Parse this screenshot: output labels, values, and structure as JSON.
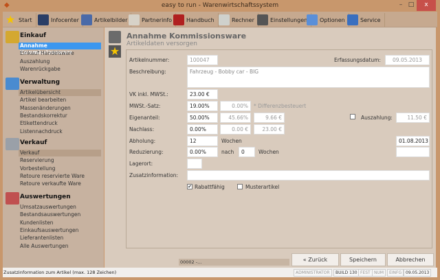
{
  "window": {
    "title": "easy to run - Warenwirtschaftssystem",
    "close": "x",
    "minimize": "–",
    "maximize": "□"
  },
  "toolbar": [
    {
      "label": "Start",
      "icon": "star-icon",
      "color": "#f5c400"
    },
    {
      "label": "Infocenter",
      "icon": "info-icon",
      "color": "#2a3e66"
    },
    {
      "label": "Artikelbilder",
      "icon": "camera-icon",
      "color": "#4a6aa8"
    },
    {
      "label": "Partnerinfo",
      "icon": "document-icon",
      "color": "#d7d2c8"
    },
    {
      "label": "Handbuch",
      "icon": "pdf-book-icon",
      "color": "#b02020"
    },
    {
      "label": "Rechner",
      "icon": "calculator-icon",
      "color": "#cfd1cc"
    },
    {
      "label": "Einstellungen",
      "icon": "tools-icon",
      "color": "#555555"
    },
    {
      "label": "Optionen",
      "icon": "options-icon",
      "color": "#5a8fd8"
    },
    {
      "label": "Service",
      "icon": "service-icon",
      "color": "#3a6fbf"
    }
  ],
  "sidebar": {
    "einkauf": {
      "title": "Einkauf",
      "items": [
        "Annahme Kommissionsware",
        "Einkauf Handelsware",
        "Auszahlung",
        "Warenrückgabe"
      ]
    },
    "verwaltung": {
      "title": "Verwaltung",
      "items": [
        "Artikelübersicht",
        "Artikel bearbeiten",
        "Massenänderungen",
        "Bestandskorrektur",
        "Etikettendruck",
        "Listennachdruck"
      ]
    },
    "verkauf": {
      "title": "Verkauf",
      "items": [
        "Verkauf",
        "Reservierung",
        "Vorbestellung",
        "Retoure reservierte Ware",
        "Retoure verkaufte Ware"
      ]
    },
    "auswertungen": {
      "title": "Auswertungen",
      "items": [
        "Umsatzauswertungen",
        "Bestandsauswertungen",
        "Kundenlisten",
        "Einkaufsauswertungen",
        "Lieferantenlisten",
        "Alle Auswertungen"
      ]
    }
  },
  "header": {
    "title": "Annahme Kommissionsware",
    "subtitle": "Artikeldaten versorgen"
  },
  "form": {
    "artikelnummer": {
      "label": "Artikelnummer:",
      "value": "100047"
    },
    "erfassungsdatum": {
      "label": "Erfassungsdatum:",
      "value": "09.05.2013"
    },
    "beschreibung": {
      "label": "Beschreibung:",
      "value": "Fahrzeug - Bobby car - BIG"
    },
    "vk": {
      "label": "VK inkl. MWSt.:",
      "value": "23.00 €"
    },
    "mwst": {
      "label": "MWSt.-Satz:",
      "value": "19.00%",
      "value2": "0.00%",
      "note": "* Differenzbesteuert"
    },
    "eigenanteil": {
      "label": "Eigenanteil:",
      "value": "50.00%",
      "value2": "45.66%",
      "value3": "9.66 €"
    },
    "auszahlung": {
      "label": "Auszahlung:",
      "value": "11.50 €",
      "checked": false
    },
    "nachlass": {
      "label": "Nachlass:",
      "value": "0.00%",
      "value2": "0.00 €",
      "value3": "23.00 €"
    },
    "abholung": {
      "label": "Abholung:",
      "value": "12",
      "unit": "Wochen",
      "date": "01.08.2013"
    },
    "reduzierung": {
      "label": "Reduzierung:",
      "value": "0.00%",
      "nach": "nach",
      "weeks": "0",
      "unit": "Wochen",
      "date": ""
    },
    "lagerort": {
      "label": "Lagerort:",
      "value": ""
    },
    "zusatz": {
      "label": "Zusatzinformation:",
      "value": ""
    },
    "rabattfaehig": {
      "label": "Rabattfähig",
      "checked": true
    },
    "musterartikel": {
      "label": "Musterartikel",
      "checked": false
    }
  },
  "footer": {
    "progress": "00002 -...",
    "back": "« Zurück",
    "save": "Speichern",
    "cancel": "Abbrechen"
  },
  "statusbar": {
    "hint": "Zusatzinformation zum Artikel (max. 128 Zeichen)",
    "user": "ADMINISTRATOR",
    "build": "BUILD 130",
    "fest": "FEST",
    "num": "NUM",
    "einfg": "EINFG",
    "date": "09.05.2013"
  }
}
